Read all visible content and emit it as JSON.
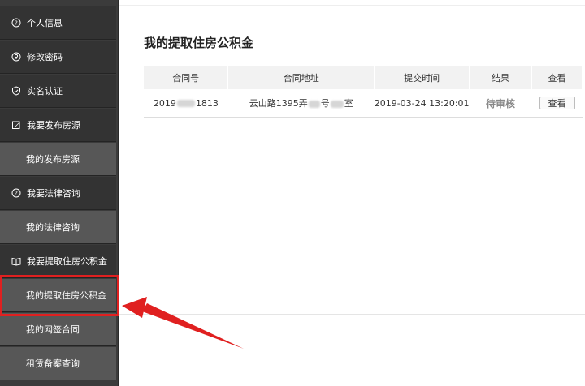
{
  "sidebar": {
    "items": [
      {
        "label": "个人信息",
        "icon": "question-circle-icon"
      },
      {
        "label": "修改密码",
        "icon": "key-circle-icon"
      },
      {
        "label": "实名认证",
        "icon": "shield-icon"
      },
      {
        "label": "我要发布房源",
        "icon": "edit-icon"
      },
      {
        "label": "我的发布房源"
      },
      {
        "label": "我要法律咨询",
        "icon": "question-circle-icon"
      },
      {
        "label": "我的法律咨询"
      },
      {
        "label": "我要提取住房公积金",
        "icon": "book-icon"
      },
      {
        "label": "我的提取住房公积金"
      },
      {
        "label": "我的网签合同"
      },
      {
        "label": "租赁备案查询"
      }
    ]
  },
  "main": {
    "title": "我的提取住房公积金",
    "table": {
      "headers": [
        "合同号",
        "合同地址",
        "提交时间",
        "结果",
        "查看"
      ],
      "rows": [
        {
          "contract_prefix": "2019",
          "contract_suffix": "1813",
          "address_part1": "云山路1395弄",
          "address_part2": "号",
          "address_part3": "室",
          "time": "2019-03-24 13:20:01",
          "result": "待审核",
          "view_label": "查看"
        }
      ]
    }
  },
  "colors": {
    "highlight": "#e02020",
    "sidebar_top": "#333333",
    "sidebar_sub": "#575757"
  }
}
